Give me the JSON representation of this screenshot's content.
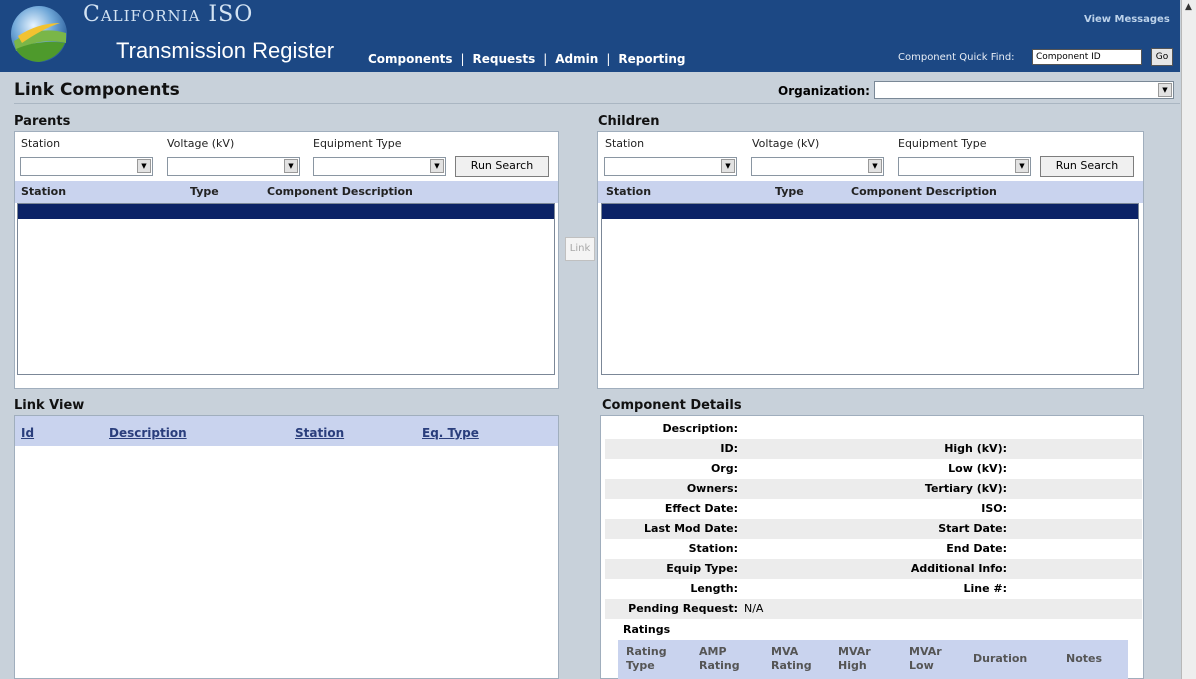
{
  "header": {
    "brand": "California ISO",
    "app_name": "Transmission Register",
    "nav": [
      "Components",
      "Requests",
      "Admin",
      "Reporting"
    ],
    "view_messages": "View Messages",
    "quick_find_label": "Component Quick Find:",
    "quick_find_value": "Component ID",
    "go_label": "Go"
  },
  "page": {
    "title": "Link Components",
    "organization_label": "Organization:",
    "organization_value": ""
  },
  "parents": {
    "title": "Parents",
    "filters": [
      "Station",
      "Voltage (kV)",
      "Equipment Type"
    ],
    "run_search": "Run Search",
    "columns": [
      "Station",
      "Type",
      "Component Description"
    ]
  },
  "children": {
    "title": "Children",
    "filters": [
      "Station",
      "Voltage (kV)",
      "Equipment Type"
    ],
    "run_search": "Run Search",
    "columns": [
      "Station",
      "Type",
      "Component Description"
    ]
  },
  "link_button": "Link",
  "link_view": {
    "title": "Link View",
    "columns": [
      "Id",
      "Description",
      "Station",
      "Eq. Type"
    ]
  },
  "details": {
    "title": "Component Details",
    "left_labels": [
      "Description:",
      "ID:",
      "Org:",
      "Owners:",
      "Effect Date:",
      "Last Mod Date:",
      "Station:",
      "Equip Type:",
      "Length:",
      "Pending Request:"
    ],
    "right_labels": [
      "High (kV):",
      "Low (kV):",
      "Tertiary (kV):",
      "ISO:",
      "Start Date:",
      "End Date:",
      "Additional Info:",
      "Line #:"
    ],
    "pending_value": "N/A",
    "ratings_title": "Ratings",
    "rating_columns": [
      [
        "Rating",
        "Type"
      ],
      [
        "AMP",
        "Rating"
      ],
      [
        "MVA",
        "Rating"
      ],
      [
        "MVAr",
        "High"
      ],
      [
        "MVAr",
        "Low"
      ],
      [
        "Duration",
        ""
      ],
      [
        "Notes",
        ""
      ]
    ]
  },
  "colors": {
    "header_bg": "#1c4884",
    "page_bg": "#c8d1da",
    "grid_header": "#c9d3ee",
    "selected_row": "#0b2266"
  }
}
